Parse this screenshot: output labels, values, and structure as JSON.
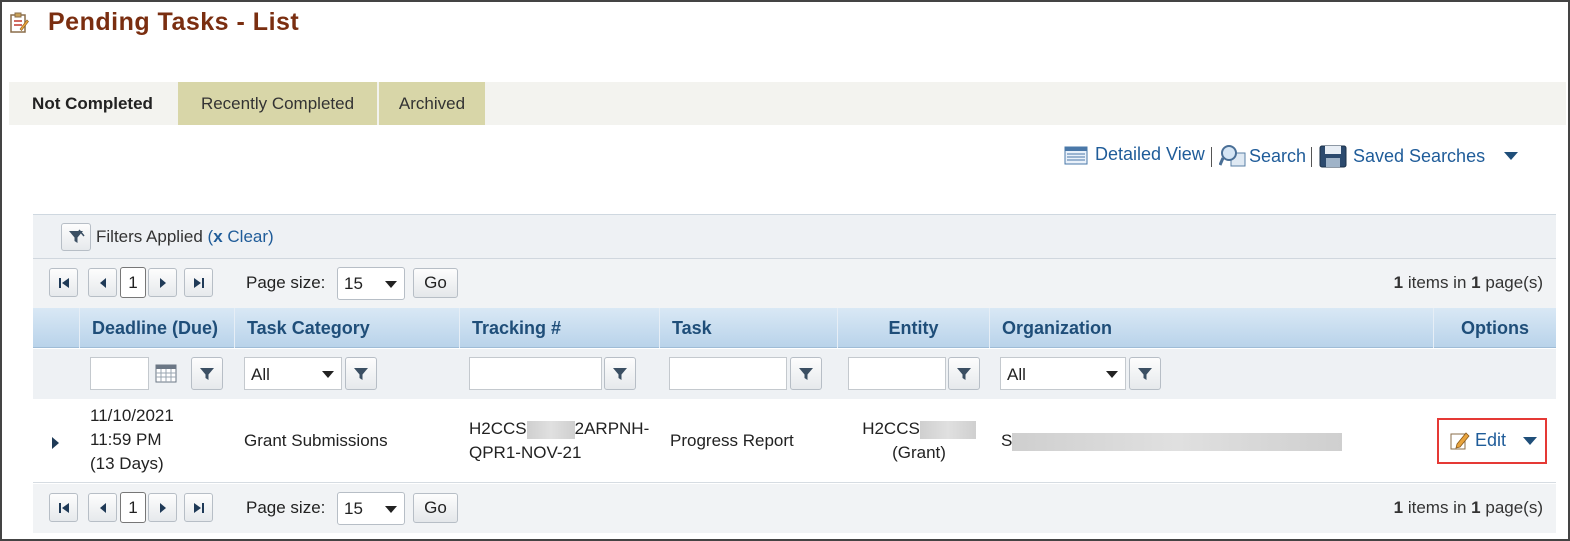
{
  "page": {
    "title": "Pending Tasks - List"
  },
  "tabs": [
    {
      "label": "Not Completed",
      "active": true
    },
    {
      "label": "Recently Completed",
      "active": false
    },
    {
      "label": "Archived",
      "active": false
    }
  ],
  "toolbar": {
    "detailed_view": "Detailed View",
    "search": "Search",
    "saved_searches": "Saved Searches"
  },
  "filters": {
    "label": "Filters Applied",
    "open_paren": "(",
    "clear_x": "x",
    "clear": "Clear",
    "close_paren": ")"
  },
  "pager": {
    "current_page": "1",
    "page_size_label": "Page size:",
    "page_size": "15",
    "go": "Go",
    "items": "1",
    "items_text": "items in",
    "pages": "1",
    "pages_text": "page(s)"
  },
  "columns": [
    "Deadline (Due)",
    "Task Category",
    "Tracking #",
    "Task",
    "Entity",
    "Organization",
    "Options"
  ],
  "column_filters": {
    "task_category": "All",
    "organization": "All"
  },
  "rows": [
    {
      "deadline_date": "11/10/2021",
      "deadline_time": "11:59 PM",
      "deadline_days": "(13 Days)",
      "task_category": "Grant Submissions",
      "tracking_line1_start": "H2CCS",
      "tracking_line1_end": "2ARPNH-",
      "tracking_line2": "QPR1-NOV-21",
      "task": "Progress Report",
      "entity_line1": "H2CCS",
      "entity_line2": "(Grant)",
      "organization_prefix": "S",
      "edit_label": "Edit"
    }
  ],
  "colors": {
    "title": "#7a2e10",
    "link": "#1f5c99",
    "header_text": "#1f4e79",
    "tab_inactive": "#d8d6a8",
    "highlight_border": "#e53935"
  },
  "icons": [
    "task-list-icon",
    "detailed-view-icon",
    "search-icon",
    "saved-searches-icon",
    "chevron-down-icon",
    "filter-icon",
    "first-page-icon",
    "prev-page-icon",
    "next-page-icon",
    "last-page-icon",
    "calendar-icon",
    "expand-row-icon",
    "edit-icon"
  ]
}
